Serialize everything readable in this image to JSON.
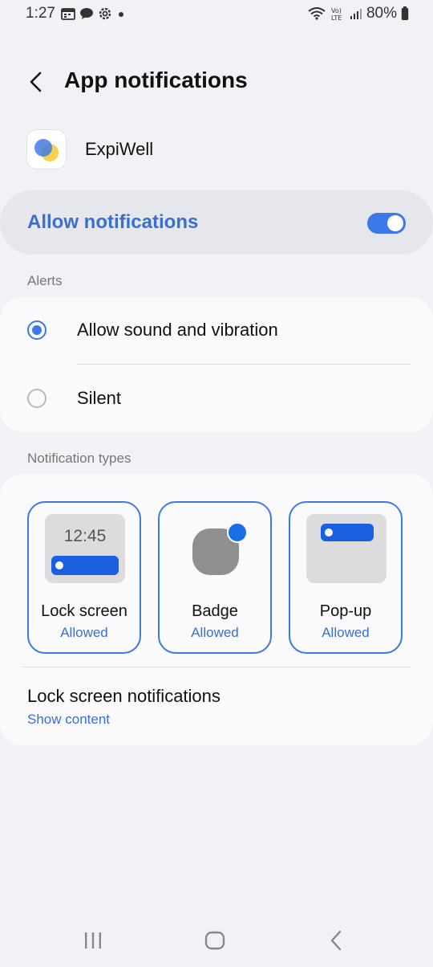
{
  "status_bar": {
    "time": "1:27",
    "left_icons": [
      "calendar-icon",
      "chat-icon",
      "settings-icon",
      "dot-icon"
    ],
    "right_icons": [
      "wifi-icon",
      "volte-icon",
      "signal-icon",
      "battery-icon"
    ],
    "battery": "80%"
  },
  "header": {
    "title": "App notifications",
    "back_icon": "back-chevron-icon"
  },
  "app": {
    "name": "ExpiWell"
  },
  "allow": {
    "label": "Allow notifications",
    "enabled": true
  },
  "alerts": {
    "section_label": "Alerts",
    "options": [
      {
        "label": "Allow sound and vibration",
        "selected": true
      },
      {
        "label": "Silent",
        "selected": false
      }
    ]
  },
  "notification_types": {
    "section_label": "Notification types",
    "tiles": [
      {
        "name": "Lock screen",
        "status": "Allowed",
        "preview_time": "12:45"
      },
      {
        "name": "Badge",
        "status": "Allowed"
      },
      {
        "name": "Pop-up",
        "status": "Allowed"
      }
    ],
    "lock_screen": {
      "title": "Lock screen notifications",
      "value": "Show content"
    }
  },
  "colors": {
    "accent": "#3b78e8",
    "accent_text": "#3a6fd0",
    "background": "#f2f2f6"
  },
  "nav": {
    "icons": [
      "recent-apps-icon",
      "home-icon",
      "back-icon"
    ]
  }
}
